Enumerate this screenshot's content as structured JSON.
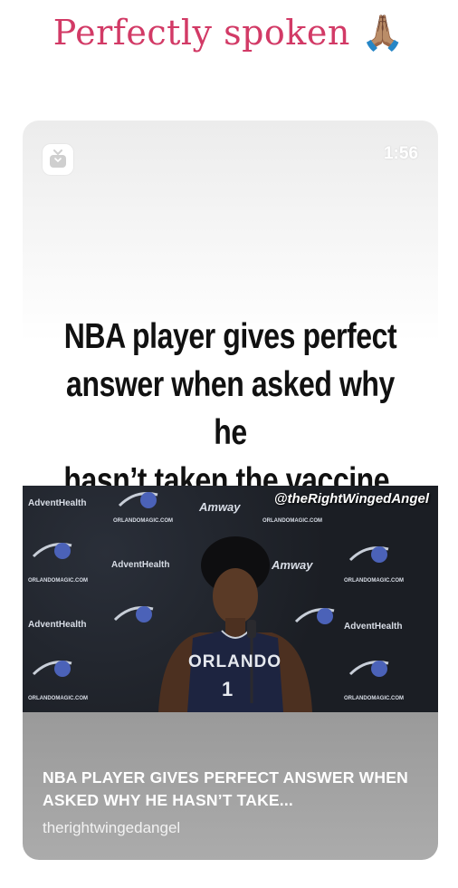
{
  "post": {
    "caption": "Perfectly spoken",
    "caption_emoji": "🙏🏽"
  },
  "card": {
    "duration": "1:56",
    "headline_lines": [
      "NBA player gives perfect",
      "answer when asked why he",
      "hasn’t taken the vaccine."
    ],
    "video": {
      "watermark": "@theRightWingedAngel",
      "sponsor_advent": "AdventHealth",
      "sponsor_amway": "Amway",
      "sponsor_url": "ORLANDOMAGIC.COM",
      "jersey_text": "ORLANDO",
      "jersey_number": "1"
    },
    "link_title": "NBA PLAYER GIVES PERFECT ANSWER WHEN ASKED WHY HE HASN’T TAKE...",
    "link_source": "therightwingedangel"
  },
  "colors": {
    "caption": "#d23a66",
    "footer": "#a3a3a3"
  },
  "icons": {
    "app": "igtv-icon",
    "prayer": "folded-hands-emoji"
  }
}
